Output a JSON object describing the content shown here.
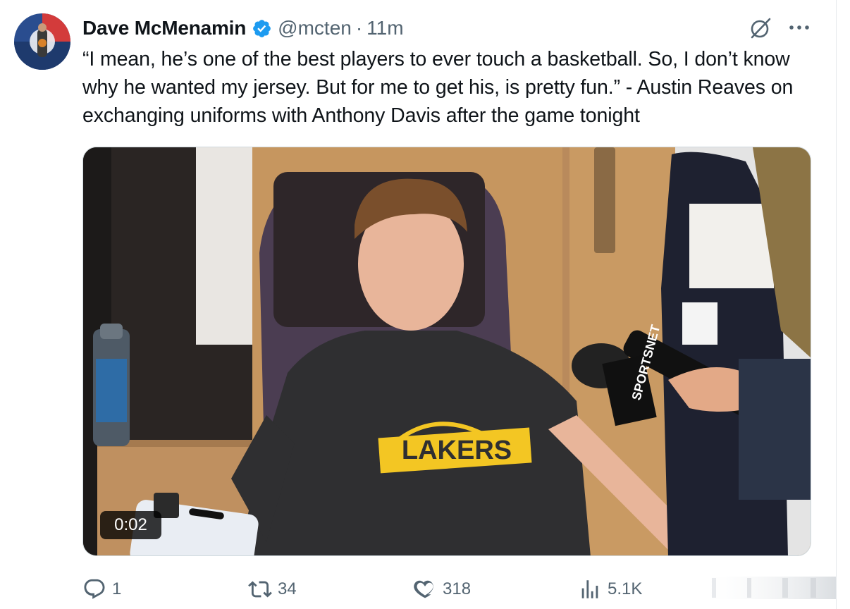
{
  "author": {
    "name": "Dave McMenamin",
    "handle": "@mcten",
    "separator": "·",
    "time": "11m",
    "verified": true
  },
  "tweet": {
    "text": "“I mean, he’s one of the best players to ever touch a basketball. So, I don’t know why he wanted my jersey. But for me to get his, is pretty fun.” - Austin Reaves on exchanging uniforms with Anthony Davis after the game tonight"
  },
  "media": {
    "type": "video",
    "duration": "0:02",
    "shirt_text": "LAKERS",
    "mic_text": "SPORTSNET"
  },
  "actions": {
    "replies": "1",
    "reposts": "34",
    "likes": "318",
    "views": "5.1K"
  },
  "colors": {
    "text": "#0f1419",
    "secondary": "#536471",
    "verified": "#1d9bf0",
    "lakers_gold": "#f3c623"
  },
  "icons": [
    "verified-badge-icon",
    "grok-icon",
    "more-icon",
    "reply-icon",
    "repost-icon",
    "like-icon",
    "views-icon"
  ]
}
